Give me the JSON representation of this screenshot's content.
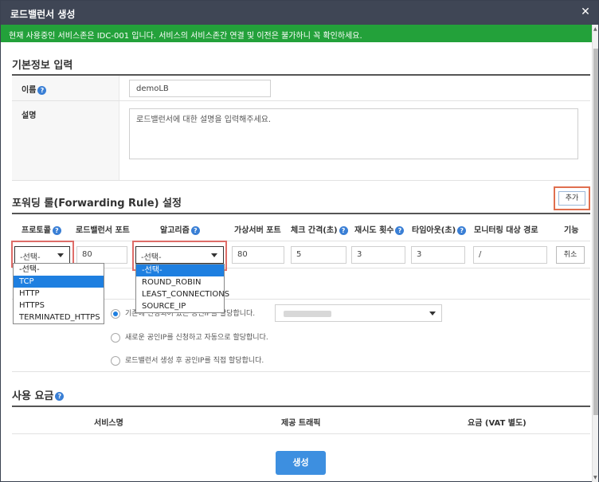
{
  "dialog": {
    "title": "로드밸런서 생성",
    "close_glyph": "✕",
    "notice": "현재 사용중인 서비스존은 IDC-001 입니다. 서비스의 서비스존간 연결 및 이전은 불가하니 꼭 확인하세요."
  },
  "basic_info": {
    "section_title": "기본정보 입력",
    "name_label": "이름",
    "name_value": "demoLB",
    "desc_label": "설명",
    "desc_placeholder": "로드밸런서에 대한 설명을 입력해주세요."
  },
  "forwarding": {
    "section_title": "포워딩 룰(Forwarding Rule) 설정",
    "add_label": "추가",
    "columns": {
      "protocol": "프로토콜",
      "lb_port": "로드밸런서 포트",
      "algorithm": "알고리즘",
      "vs_port": "가상서버 포트",
      "check_interval": "체크 간격(초)",
      "retry_count": "재시도 횟수",
      "timeout": "타임아웃(초)",
      "monitor_path": "모니터링 대상 경로",
      "action": "기능"
    },
    "row": {
      "protocol_value": "-선택-",
      "lb_port": "80",
      "algorithm_value": "-선택-",
      "vs_port": "80",
      "check_interval": "5",
      "retry_count": "3",
      "timeout": "3",
      "monitor_path": "/",
      "cancel_label": "취소"
    },
    "protocol_options": [
      "-선택-",
      "TCP",
      "HTTP",
      "HTTPS",
      "TERMINATED_HTTPS"
    ],
    "protocol_highlighted": "TCP",
    "algorithm_options": [
      "-선택-",
      "ROUND_ROBIN",
      "LEAST_CONNECTIONS",
      "SOURCE_IP"
    ],
    "algorithm_highlighted": "-선택-"
  },
  "public_ip": {
    "option1": "기존에 신청되어 있는 공인IP를 할당합니다.",
    "option2": "새로운 공인IP를 신청하고 자동으로 할당합니다.",
    "option3": "로드밸런서 생성 후 공인IP를 직접 할당합니다.",
    "selected_option": 1
  },
  "fees": {
    "section_title": "사용 요금",
    "col_service": "서비스명",
    "col_traffic": "제공 트래픽",
    "col_fee": "요금 (VAT 별도)"
  },
  "footer": {
    "create_label": "생성"
  },
  "colors": {
    "titlebar": "#3f4655",
    "notice_bg": "#23a13a",
    "accent": "#3d8fe0",
    "highlight_box": "#d9534f"
  }
}
